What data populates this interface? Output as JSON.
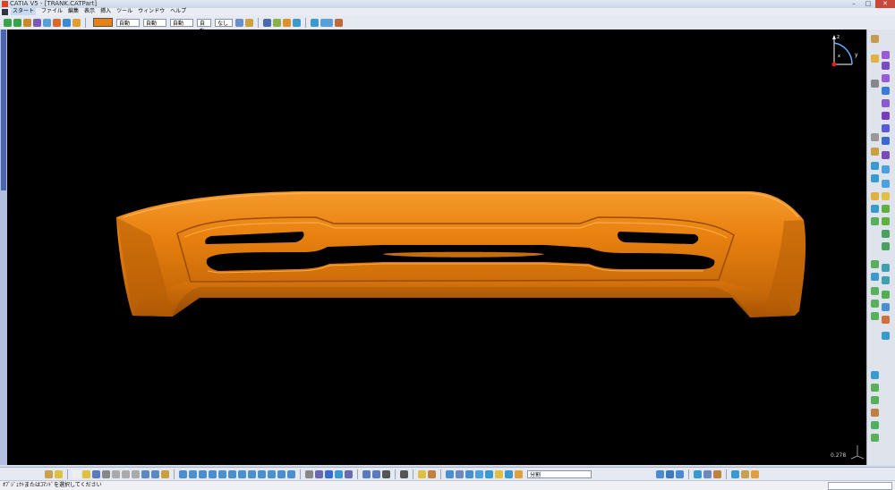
{
  "window": {
    "title": "CATIA V5 - [TRANK.CATPart]"
  },
  "menu": {
    "items": [
      "スタート",
      "ファイル",
      "編集",
      "表示",
      "挿入",
      "ツール",
      "ウィンドウ",
      "ヘルプ"
    ]
  },
  "toolbar": {
    "color": "#e8810f",
    "dropdowns": [
      "自動",
      "自動",
      "自動",
      "自動",
      "なし"
    ]
  },
  "bottom_toolbar": {
    "dropdown": "分割"
  },
  "viewport": {
    "background": "#000000",
    "part_color": "#e8810f",
    "scale_label": "0.278",
    "compass_labels": {
      "z": "z",
      "x": "x",
      "y": "y"
    }
  },
  "status": {
    "message": "ｵﾌﾞｼﾞｪｸﾄまたはｺﾏﾝﾄﾞを選択してください"
  }
}
